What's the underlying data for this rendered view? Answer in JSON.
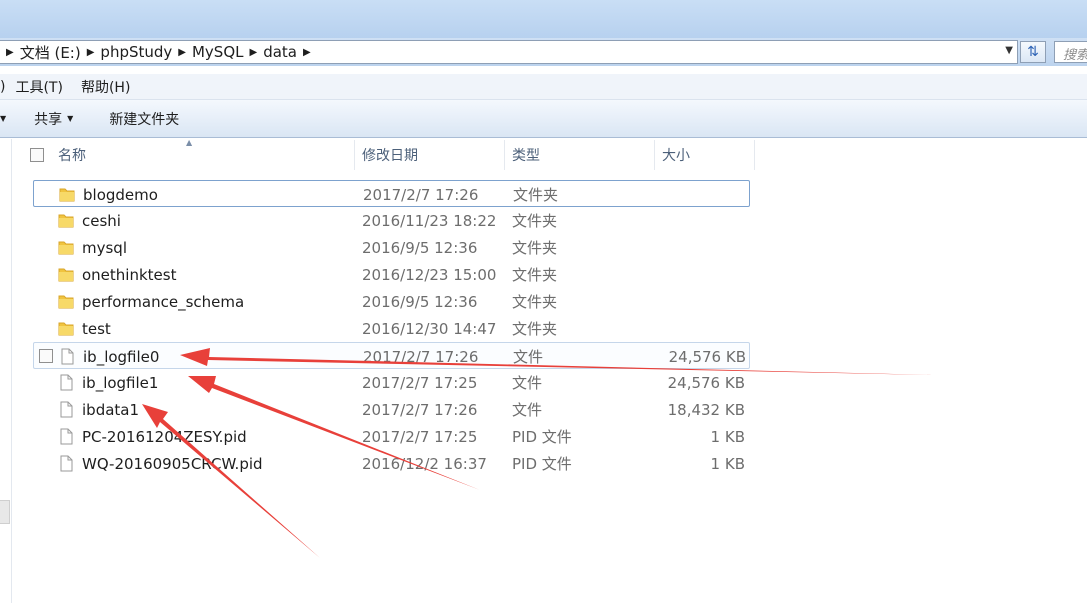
{
  "address": {
    "crumbs": [
      "文档 (E:)",
      "phpStudy",
      "MySQL",
      "data"
    ],
    "search_placeholder": "搜索"
  },
  "menu": {
    "paren": ")",
    "tools": "工具(T)",
    "help": "帮助(H)"
  },
  "toolbar": {
    "share": "共享",
    "new_folder": "新建文件夹"
  },
  "columns": {
    "name": "名称",
    "date": "修改日期",
    "type": "类型",
    "size": "大小"
  },
  "files": [
    {
      "name": "blogdemo",
      "date": "2017/2/7 17:26",
      "type": "文件夹",
      "size": "",
      "icon": "folder-icon"
    },
    {
      "name": "ceshi",
      "date": "2016/11/23 18:22",
      "type": "文件夹",
      "size": "",
      "icon": "folder-icon"
    },
    {
      "name": "mysql",
      "date": "2016/9/5 12:36",
      "type": "文件夹",
      "size": "",
      "icon": "folder-icon"
    },
    {
      "name": "onethinktest",
      "date": "2016/12/23 15:00",
      "type": "文件夹",
      "size": "",
      "icon": "folder-icon"
    },
    {
      "name": "performance_schema",
      "date": "2016/9/5 12:36",
      "type": "文件夹",
      "size": "",
      "icon": "folder-icon"
    },
    {
      "name": "test",
      "date": "2016/12/30 14:47",
      "type": "文件夹",
      "size": "",
      "icon": "folder-icon"
    },
    {
      "name": "ib_logfile0",
      "date": "2017/2/7 17:26",
      "type": "文件",
      "size": "24,576 KB",
      "icon": "file-icon"
    },
    {
      "name": "ib_logfile1",
      "date": "2017/2/7 17:25",
      "type": "文件",
      "size": "24,576 KB",
      "icon": "file-icon"
    },
    {
      "name": "ibdata1",
      "date": "2017/2/7 17:26",
      "type": "文件",
      "size": "18,432 KB",
      "icon": "file-icon"
    },
    {
      "name": "PC-20161204ZESY.pid",
      "date": "2017/2/7 17:25",
      "type": "PID 文件",
      "size": "1 KB",
      "icon": "file-icon"
    },
    {
      "name": "WQ-20160905CRCW.pid",
      "date": "2016/12/2 16:37",
      "type": "PID 文件",
      "size": "1 KB",
      "icon": "file-icon"
    }
  ],
  "colors": {
    "arrow": "#e8403a",
    "selection_border": "#7da2ce",
    "folder": "#f0c43f"
  }
}
